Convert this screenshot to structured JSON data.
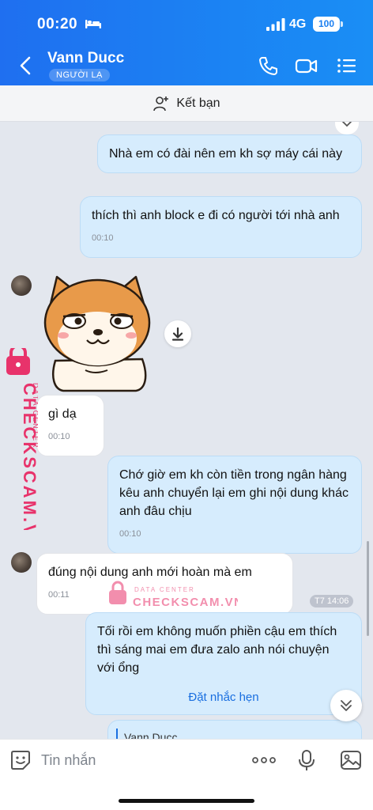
{
  "status": {
    "time": "00:20",
    "network": "4G",
    "battery": "100"
  },
  "header": {
    "name": "Vann Ducc",
    "tag": "NGƯỜI LẠ"
  },
  "addfriend": {
    "label": "Kết bạn"
  },
  "messages": [
    {
      "id": "m1",
      "type": "sent",
      "text": "Nhà em có đài nên em kh sợ máy cái này"
    },
    {
      "id": "m2",
      "type": "sent",
      "text": "thích thì anh block e đi có người tới nhà anh",
      "time": "00:10"
    },
    {
      "id": "m3",
      "type": "sticker",
      "desc": "shiba-sticker"
    },
    {
      "id": "m4",
      "type": "recv",
      "text": "gì dạ",
      "time": "00:10"
    },
    {
      "id": "m5",
      "type": "sent",
      "text": "Chớ giờ em kh còn tiền trong ngân hàng kêu anh chuyển lại em ghi nội dung khác anh đâu chịu",
      "time": "00:10"
    },
    {
      "id": "m6",
      "type": "recv",
      "text": "đúng nội dung anh mới hoàn mà em",
      "time": "00:11"
    },
    {
      "id": "m7",
      "type": "sent",
      "text": "Tối rồi em không muốn phiền cậu em thích thì sáng mai em đưa zalo anh nói chuyện với ổng",
      "action": "Đặt nhắc hẹn"
    },
    {
      "id": "m8",
      "type": "sent",
      "quote": "Vann Ducc"
    }
  ],
  "timechip": "T7 14:06",
  "watermark": {
    "top": "DATA CENTER",
    "main": "CHECKSCAM.VN"
  },
  "input": {
    "placeholder": "Tin nhắn"
  },
  "colors": {
    "header": "#1b7ff1",
    "sent_bubble": "#d6ecfd",
    "chat_bg": "#e3e7ee",
    "watermark": "#e8336b"
  }
}
